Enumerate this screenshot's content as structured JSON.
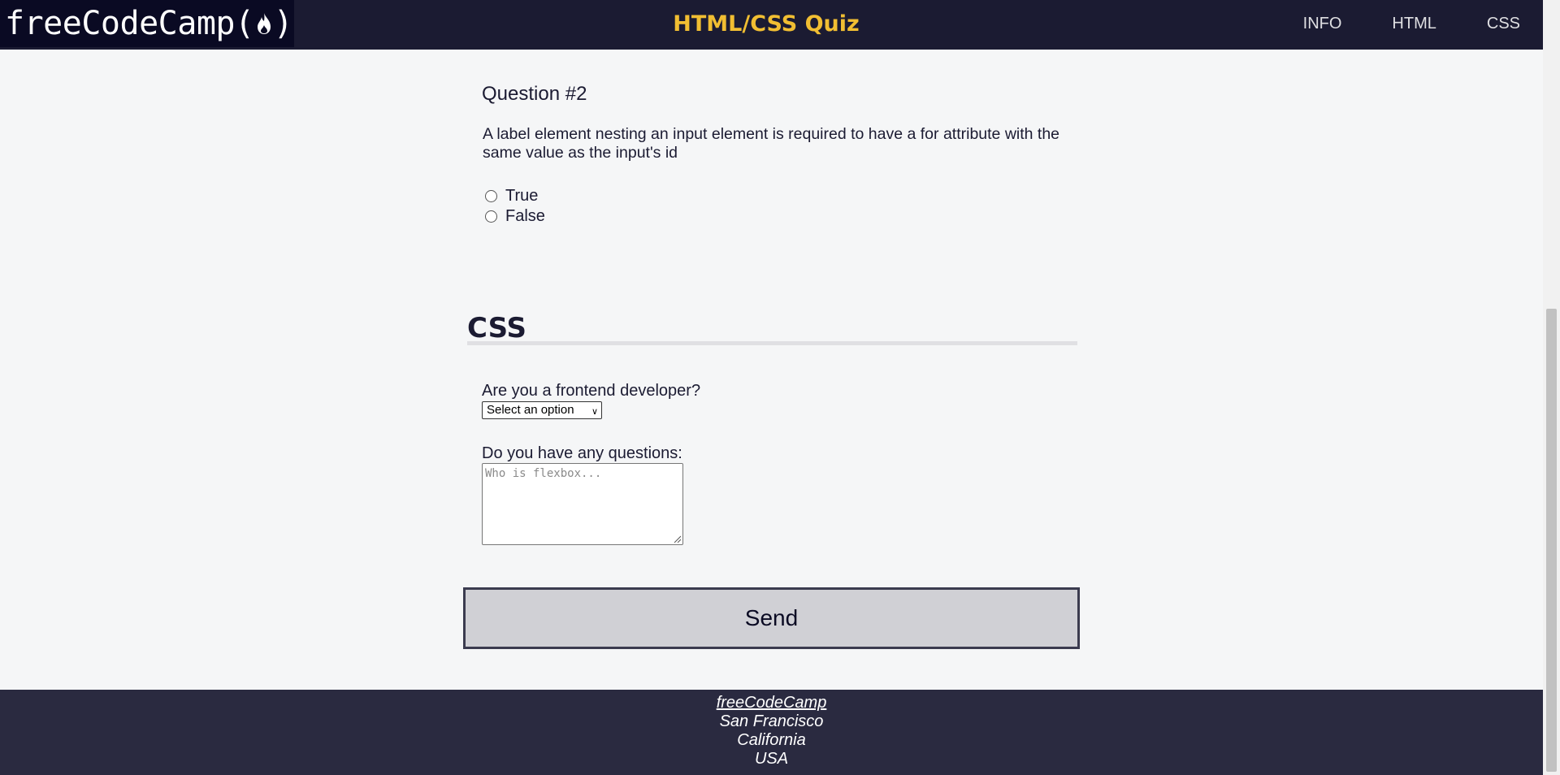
{
  "header": {
    "logo_text_before": "freeCodeCamp(",
    "logo_text_after": ")",
    "title": "HTML/CSS Quiz",
    "nav": [
      "INFO",
      "HTML",
      "CSS"
    ]
  },
  "question": {
    "title": "Question #2",
    "text": "A label element nesting an input element is required to have a for attribute with the same value as the input's id",
    "options": [
      "True",
      "False"
    ]
  },
  "css_section": {
    "heading": "CSS",
    "frontend_label": "Are you a frontend developer?",
    "select_value": "Select an option",
    "questions_label": "Do you have any questions:",
    "textarea_placeholder": "Who is flexbox...",
    "send_label": "Send"
  },
  "footer": {
    "link": "freeCodeCamp",
    "city": "San Francisco",
    "state": "California",
    "country": "USA"
  },
  "colors": {
    "header_bg": "#1b1b32",
    "title_accent": "#f1be32",
    "page_bg": "#f5f6f7",
    "footer_bg": "#2a2a40",
    "button_bg": "#d0d0d5"
  }
}
